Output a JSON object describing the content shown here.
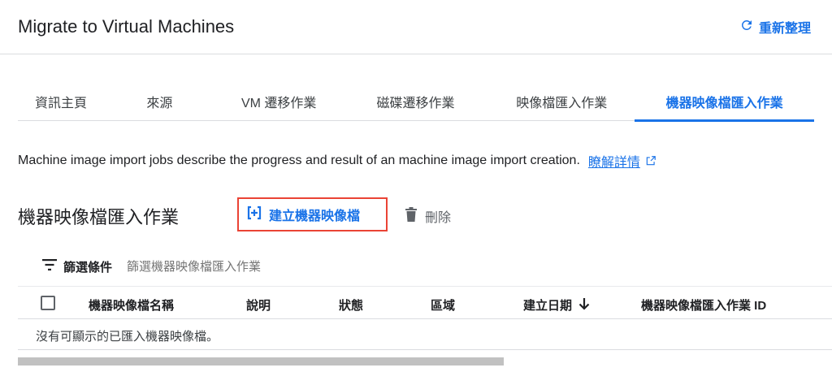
{
  "header": {
    "title": "Migrate to Virtual Machines",
    "refresh_label": "重新整理"
  },
  "tabs": [
    {
      "label": "資訊主頁",
      "active": false
    },
    {
      "label": "來源",
      "active": false
    },
    {
      "label": "VM 遷移作業",
      "active": false
    },
    {
      "label": "磁碟遷移作業",
      "active": false
    },
    {
      "label": "映像檔匯入作業",
      "active": false
    },
    {
      "label": "機器映像檔匯入作業",
      "active": true
    }
  ],
  "description": {
    "text": "Machine image import jobs describe the progress and result of an machine image import creation.",
    "link_label": "瞭解詳情"
  },
  "section": {
    "title": "機器映像檔匯入作業"
  },
  "toolbar": {
    "create_label": "建立機器映像檔",
    "delete_label": "刪除"
  },
  "filter": {
    "label": "篩選條件",
    "placeholder": "篩選機器映像檔匯入作業"
  },
  "table": {
    "columns": [
      "機器映像檔名稱",
      "說明",
      "狀態",
      "區域",
      "建立日期",
      "機器映像檔匯入作業 ID"
    ],
    "sorted_column": "建立日期",
    "sort_direction": "descending",
    "empty_message": "沒有可顯示的已匯入機器映像檔。"
  },
  "colors": {
    "accent": "#1a73e8",
    "highlight_border": "#ea4335"
  }
}
